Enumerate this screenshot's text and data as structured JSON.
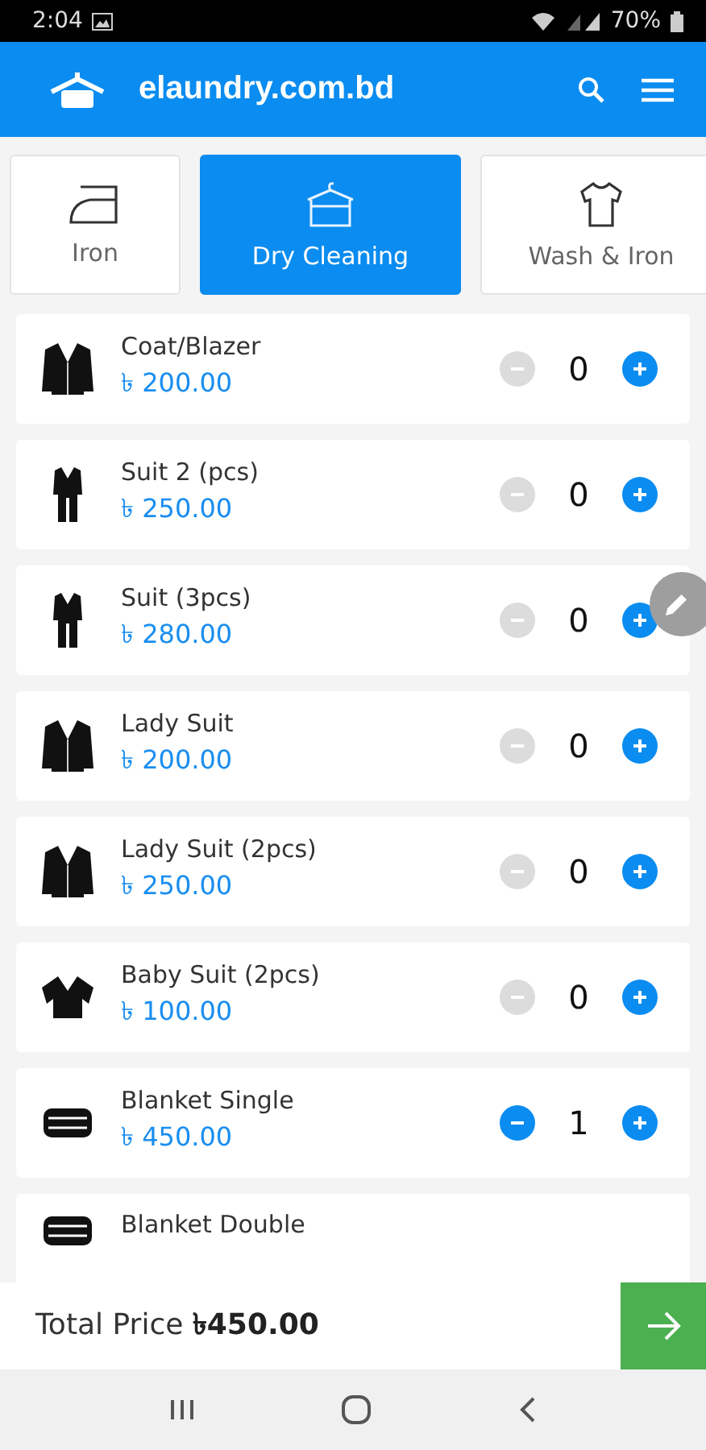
{
  "status_bar": {
    "time": "2:04",
    "battery": "70%"
  },
  "app_bar": {
    "title": "elaundry.com.bd"
  },
  "tabs": [
    {
      "label": "Iron",
      "selected": false
    },
    {
      "label": "Dry Cleaning",
      "selected": true
    },
    {
      "label": "Wash & Iron",
      "selected": false
    }
  ],
  "items": [
    {
      "name": "Coat/Blazer",
      "price": "৳ 200.00",
      "quantity": "0",
      "decrease_disabled": true
    },
    {
      "name": "Suit 2 (pcs)",
      "price": "৳ 250.00",
      "quantity": "0",
      "decrease_disabled": true
    },
    {
      "name": "Suit (3pcs)",
      "price": "৳ 280.00",
      "quantity": "0",
      "decrease_disabled": true
    },
    {
      "name": "Lady Suit",
      "price": "৳ 200.00",
      "quantity": "0",
      "decrease_disabled": true
    },
    {
      "name": "Lady Suit (2pcs)",
      "price": "৳ 250.00",
      "quantity": "0",
      "decrease_disabled": true
    },
    {
      "name": "Baby Suit (2pcs)",
      "price": "৳ 100.00",
      "quantity": "0",
      "decrease_disabled": true
    },
    {
      "name": "Blanket Single",
      "price": "৳ 450.00",
      "quantity": "1",
      "decrease_disabled": false
    },
    {
      "name": "Blanket Double"
    }
  ],
  "total": {
    "label": "Total Price",
    "amount": "৳450.00"
  }
}
